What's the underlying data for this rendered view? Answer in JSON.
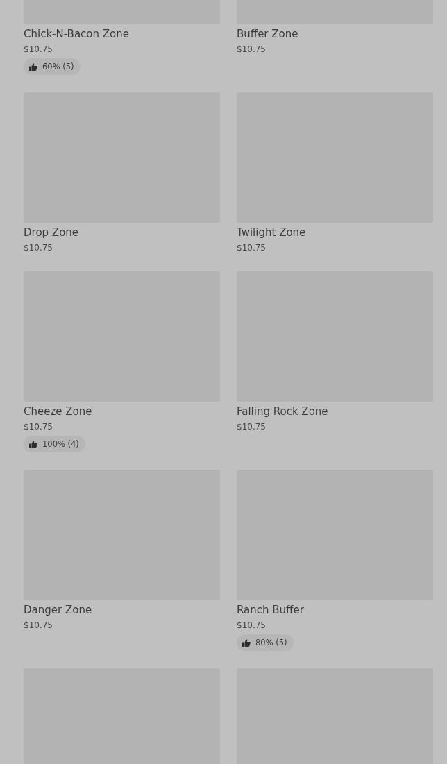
{
  "items": [
    {
      "kind": "product",
      "name": "Chick-N-Bacon Zone",
      "price": "$10.75",
      "rating": "60% (5)"
    },
    {
      "kind": "product",
      "name": "Buffer Zone",
      "price": "$10.75"
    },
    {
      "kind": "product",
      "name": "Drop Zone",
      "price": "$10.75"
    },
    {
      "kind": "product",
      "name": "Twilight Zone",
      "price": "$10.75"
    },
    {
      "kind": "product",
      "name": "Cheeze Zone",
      "price": "$10.75",
      "rating": "100% (4)"
    },
    {
      "kind": "product",
      "name": "Falling Rock Zone",
      "price": "$10.75"
    },
    {
      "kind": "product",
      "name": "Danger Zone",
      "price": "$10.75"
    },
    {
      "kind": "product",
      "name": "Ranch Buffer",
      "price": "$10.75",
      "rating": "80% (5)"
    },
    {
      "kind": "cut_off"
    },
    {
      "kind": "cut_off"
    }
  ]
}
